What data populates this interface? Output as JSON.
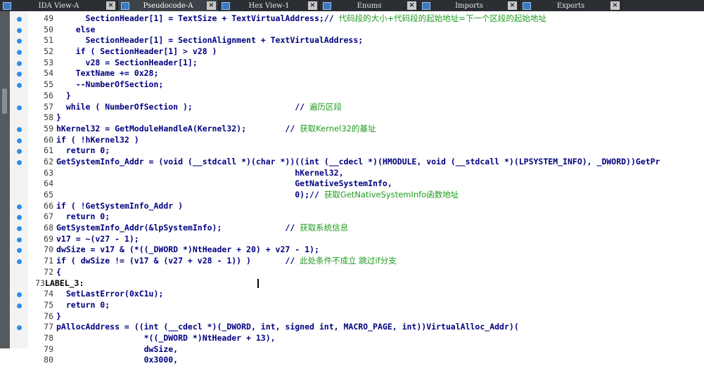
{
  "tabs": [
    {
      "label": "IDA View-A",
      "icon": "ida-view-icon"
    },
    {
      "label": "Pseudocode-A",
      "icon": "pseudocode-icon"
    },
    {
      "label": "Hex View-1",
      "icon": "hex-view-icon"
    },
    {
      "label": "Enums",
      "icon": "enums-icon"
    },
    {
      "label": "Imports",
      "icon": "imports-icon"
    },
    {
      "label": "Exports",
      "icon": "exports-icon"
    }
  ],
  "tab_close_glyph": "×",
  "colors": {
    "keyword": "#000080",
    "comment": "#1f9c1f",
    "breakpoint_dot": "#2c8fe8",
    "tabbar": "#2b2f33"
  },
  "lines": [
    {
      "n": "49",
      "dot": true,
      "text": "      SectionHeader[1] = TextSize + TextVirtualAddress;// ",
      "comment": "代码段的大小+代码段的起始地址=下一个区段的起始地址"
    },
    {
      "n": "50",
      "dot": true,
      "text": "    else",
      "comment": ""
    },
    {
      "n": "51",
      "dot": true,
      "text": "      SectionHeader[1] = SectionAlignment + TextVirtualAddress;",
      "comment": ""
    },
    {
      "n": "52",
      "dot": true,
      "text": "    if ( SectionHeader[1] > v28 )",
      "comment": ""
    },
    {
      "n": "53",
      "dot": true,
      "text": "      v28 = SectionHeader[1];",
      "comment": ""
    },
    {
      "n": "54",
      "dot": true,
      "text": "    TextName += 0x28;",
      "comment": ""
    },
    {
      "n": "55",
      "dot": true,
      "text": "    --NumberOfSection;",
      "comment": ""
    },
    {
      "n": "56",
      "dot": false,
      "text": "  }",
      "comment": ""
    },
    {
      "n": "57",
      "dot": true,
      "text": "  while ( NumberOfSection );                     // ",
      "comment": "遍历区段"
    },
    {
      "n": "58",
      "dot": false,
      "text": "}",
      "comment": ""
    },
    {
      "n": "59",
      "dot": true,
      "text": "hKernel32 = GetModuleHandleA(Kernel32);        // ",
      "comment": "获取Kernel32的基址"
    },
    {
      "n": "60",
      "dot": true,
      "text": "if ( !hKernel32 )",
      "comment": ""
    },
    {
      "n": "61",
      "dot": true,
      "text": "  return 0;",
      "comment": ""
    },
    {
      "n": "62",
      "dot": true,
      "text": "GetSystemInfo_Addr = (void (__stdcall *)(char *))((int (__cdecl *)(HMODULE, void (__stdcall *)(LPSYSTEM_INFO), _DWORD))GetPr",
      "comment": ""
    },
    {
      "n": "63",
      "dot": false,
      "text": "                                                 hKernel32,",
      "comment": ""
    },
    {
      "n": "64",
      "dot": false,
      "text": "                                                 GetNativeSystemInfo,",
      "comment": ""
    },
    {
      "n": "65",
      "dot": false,
      "text": "                                                 0);// ",
      "comment": "获取GetNativeSystemInfo函数地址"
    },
    {
      "n": "66",
      "dot": true,
      "text": "if ( !GetSystemInfo_Addr )",
      "comment": ""
    },
    {
      "n": "67",
      "dot": true,
      "text": "  return 0;",
      "comment": ""
    },
    {
      "n": "68",
      "dot": true,
      "text": "GetSystemInfo_Addr(&lpSystemInfo);             // ",
      "comment": "获取系统信息"
    },
    {
      "n": "69",
      "dot": true,
      "text": "v17 = ~(v27 - 1);",
      "comment": ""
    },
    {
      "n": "70",
      "dot": true,
      "text": "dwSize = v17 & (*((_DWORD *)NtHeader + 20) + v27 - 1);",
      "comment": ""
    },
    {
      "n": "71",
      "dot": true,
      "text": "if ( dwSize != (v17 & (v27 + v28 - 1)) )       // ",
      "comment": "此处条件不成立 跳过if分支"
    },
    {
      "n": "72",
      "dot": false,
      "text": "{",
      "comment": ""
    },
    {
      "n": "73",
      "dot": false,
      "label": true,
      "text": "LABEL_3:",
      "comment": ""
    },
    {
      "n": "74",
      "dot": true,
      "text": "  SetLastError(0xC1u);",
      "comment": ""
    },
    {
      "n": "75",
      "dot": true,
      "text": "  return 0;",
      "comment": ""
    },
    {
      "n": "76",
      "dot": false,
      "text": "}",
      "comment": ""
    },
    {
      "n": "77",
      "dot": true,
      "text": "pAllocAddress = ((int (__cdecl *)(_DWORD, int, signed int, MACRO_PAGE, int))VirtualAlloc_Addr)(",
      "comment": ""
    },
    {
      "n": "78",
      "dot": false,
      "text": "                  *((_DWORD *)NtHeader + 13),",
      "comment": ""
    },
    {
      "n": "79",
      "dot": false,
      "text": "                  dwSize,",
      "comment": ""
    },
    {
      "n": "80",
      "dot": false,
      "text": "                  0x3000,",
      "comment": ""
    }
  ]
}
